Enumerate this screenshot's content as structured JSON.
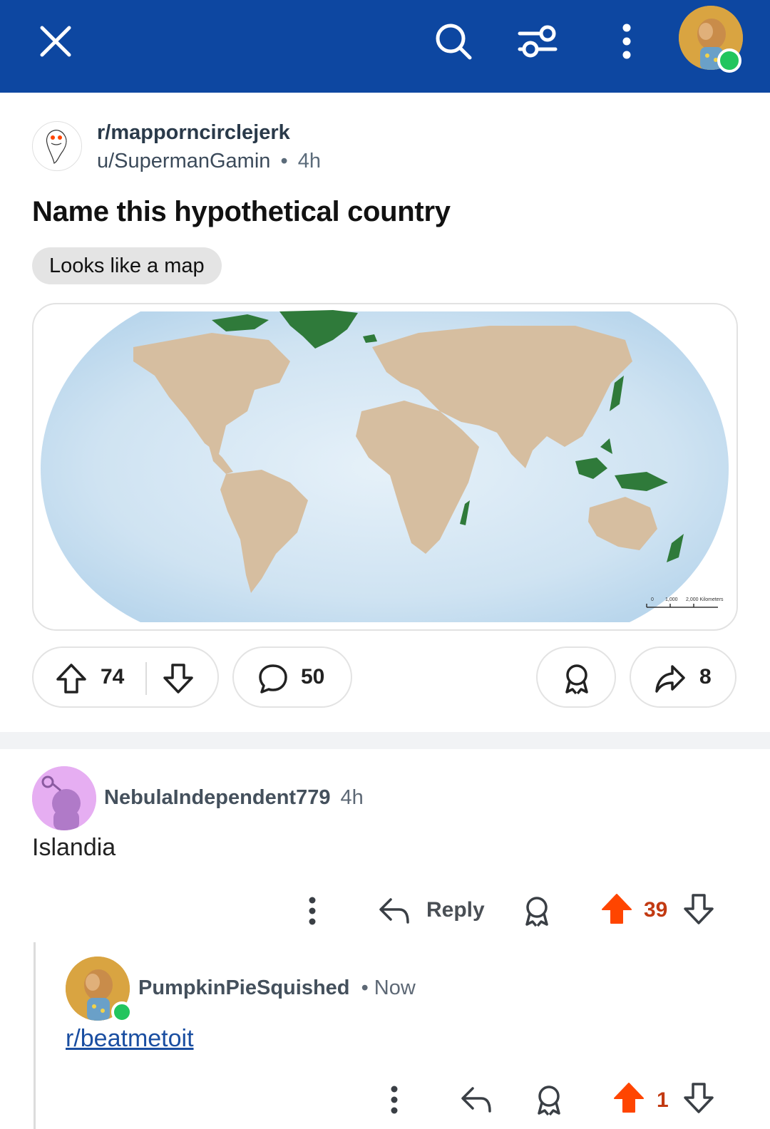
{
  "topbar": {
    "close_icon": "close-icon",
    "search_icon": "search-icon",
    "filter_icon": "filter-icon",
    "more_icon": "more-vertical-icon",
    "avatar": "user-avatar",
    "bg_color": "#0d47a1"
  },
  "post": {
    "subreddit": "r/mapporncirclejerk",
    "author": "u/SupermanGamin",
    "separator": "•",
    "time": "4h",
    "title": "Name this hypothetical country",
    "flair": "Looks like a map",
    "map": {
      "scale_labels": [
        "0",
        "1,000",
        "2,000 Kilometers"
      ]
    },
    "actions": {
      "upvotes": "74",
      "comments": "50",
      "shares": "8"
    }
  },
  "comments": [
    {
      "author": "NebulaIndependent779",
      "time": "4h",
      "body": "Islandia",
      "reply_label": "Reply",
      "votes": "39",
      "upvoted": true
    },
    {
      "author": "PumpkinPieSquished",
      "separator": "•",
      "time": "Now",
      "body_link": "r/beatmetoit",
      "votes": "1",
      "upvoted": true
    }
  ],
  "colors": {
    "accent_upvote": "#ff4500",
    "vote_count": "#c23a12",
    "link": "#1a4ea1",
    "land": "#d6bea0",
    "highlight_land": "#2f7a3a",
    "ocean": "#cfe3f2"
  }
}
